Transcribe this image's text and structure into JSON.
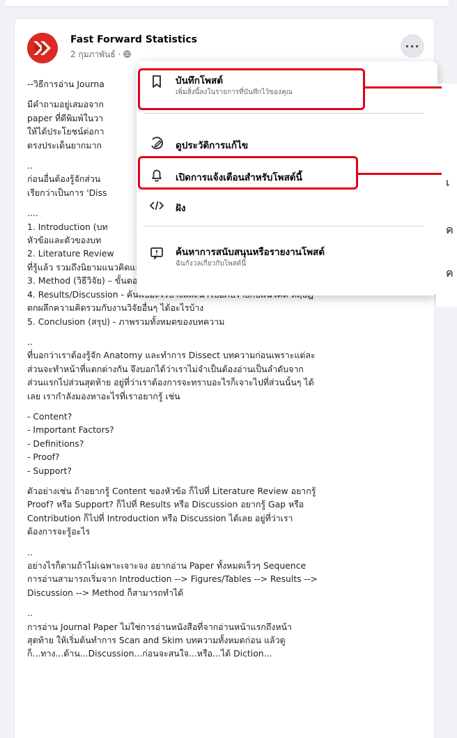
{
  "post": {
    "author": "Fast Forward Statistics",
    "date": "2 กุมภาพันธ์ · ",
    "more_label": "···"
  },
  "body": {
    "p1": [
      "--วิธีการอ่าน Journa"
    ],
    "p2": [
      "มีคำถามอยู่เสมอจาก",
      "paper ที่ดีพิมพ์ในวา",
      "ให้ได้ประโยชน์ต่อกา",
      "ตรงประเด็นยากมาก"
    ],
    "p3": [
      "..",
      "ก่อนอื่นต้องรู้จักส่วน",
      "เรียกว่าเป็นการ 'Diss"
    ],
    "p4": [
      "....",
      "1. Introduction (บท",
      "หัวข้อและตัวของบท",
      "2. Literature Review",
      "ที่รู้แล้ว รวมถึงนิยามแนวคิดและสมมุติฐานที่นำเสนอ",
      "3. Method (วิธีวิจัย) – ขั้นตอน วิธีการวิจัยเก็บข้อมูล การวิเคราะห์ ทำอะไรบ้าง",
      "4. Results/Discussion - ค้นพบอะไรบ้างและนำไปอภิปรายกับแนวคิด ทฤษฎี",
      "ตกผลึกความคิดรวมกับงานวิจัยอื่นๆ ได้อะไรบ้าง",
      "5. Conclusion (สรุป) - ภาพรวมทั้งหมดของบทความ"
    ],
    "p5": [
      "..",
      "ที่บอกว่าเราต้องรู้จัก Anatomy และทำการ Dissect บทความก่อนเพราะแต่ละ",
      "ส่วนจะทำหน้าที่แตกต่างกัน จึงบอกได้ว่าเราไม่จำเป็นต้องอ่านเป็นลำดับจาก",
      "ส่วนแรกไปส่วนสุดท้าย อยู่ที่ว่าเราต้องการจะทราบอะไรก็เจาะไปที่ส่วนนั้นๆ ได้",
      "เลย เรากำลังมองหาอะไรที่เราอยากรู้ เช่น"
    ],
    "p6": [
      "- Content?",
      "- Important Factors?",
      "- Definitions?",
      "- Proof?",
      "- Support?"
    ],
    "p7": [
      "ตัวอย่างเช่น ถ้าอยากรู้ Content ของหัวข้อ ก็ไปที่ Literature Review   อยากรู้",
      "Proof? หรือ Support? ก็ไปที่ Results หรือ Discussion  อยากรู้ Gap หรือ",
      "Contribution ก็ไปที่ Introduction หรือ Discussion ได้เลย อยู่ที่ว่าเรา",
      "ต้องการจะรู้อะไร"
    ],
    "p8": [
      "..",
      "อย่างไรก็ตามถ้าไม่เฉพาะเจาะจง อยากอ่าน Paper ทั้งหมดเร็วๆ Sequence",
      "การอ่านสามารถเริ่มจาก Introduction --> Figures/Tables --> Results -->",
      "Discussion --> Method ก็สามารถทำได้"
    ],
    "p9": [
      "..",
      "การอ่าน Journal Paper ไม่ใช่การอ่านหนังสือที่จากอ่านหน้าแรกถึงหน้า",
      "สุดท้าย ให้เริ่มต้นทำการ Scan and Skim บทความทั้งหมดก่อน  แล้วดู",
      "ก็...ทาง...ด้าน...Discussion...ก่อนจะสนใจ...หรือ...ได้ Diction..."
    ]
  },
  "menu": {
    "items": [
      {
        "label": "บันทึกโพสต์",
        "sub": "เพิ่มสิ่งนี้ลงในรายการที่บันทึกไว้ของคุณ",
        "icon": "bookmark-icon"
      },
      {
        "label": "ดูประวัติการแก้ไข",
        "icon": "edit-history-icon"
      },
      {
        "label": "เปิดการแจ้งเตือนสำหรับโพสต์นี้",
        "icon": "bell-icon"
      },
      {
        "label": "ฝัง",
        "icon": "embed-code-icon"
      },
      {
        "label": "ค้นหาการสนับสนุนหรือรายงานโพสต์",
        "sub": "ฉันกังวลเกี่ยวกับโพสต์นี้",
        "icon": "report-flag-icon"
      }
    ]
  },
  "edge_chars": [
    "เ",
    "ค",
    "ค"
  ],
  "colors": {
    "highlight": "#e0001b",
    "avatar": "#d92b22"
  }
}
